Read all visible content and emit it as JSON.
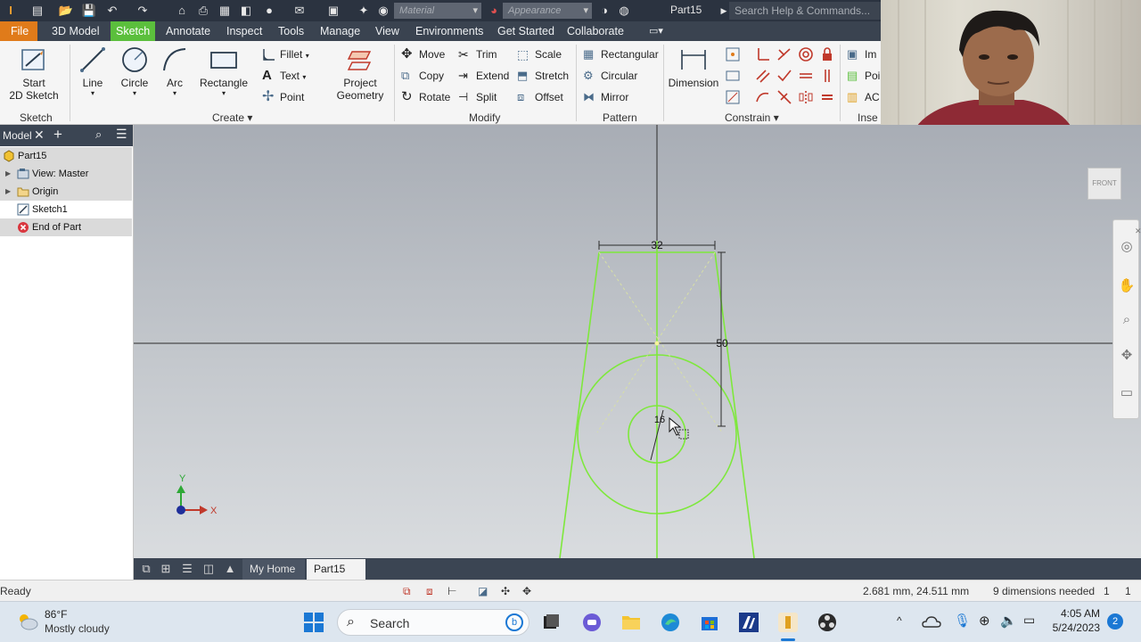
{
  "titlebar": {
    "doc_title": "Part15",
    "material_placeholder": "Material",
    "appearance_placeholder": "Appearance",
    "help_search_placeholder": "Search Help & Commands..."
  },
  "menu_tabs": [
    "File",
    "3D Model",
    "Sketch",
    "Annotate",
    "Inspect",
    "Tools",
    "Manage",
    "View",
    "Environments",
    "Get Started",
    "Collaborate"
  ],
  "active_tab": "Sketch",
  "ribbon": {
    "sketch_group": {
      "start_line1": "Start",
      "start_line2": "2D Sketch",
      "label": "Sketch"
    },
    "create_group": {
      "line": "Line",
      "circle": "Circle",
      "arc": "Arc",
      "rectangle": "Rectangle",
      "fillet": "Fillet",
      "text": "Text",
      "point": "Point",
      "label": "Create"
    },
    "project": {
      "line1": "Project",
      "line2": "Geometry"
    },
    "modify_group": {
      "move": "Move",
      "trim": "Trim",
      "scale": "Scale",
      "copy": "Copy",
      "extend": "Extend",
      "stretch": "Stretch",
      "rotate": "Rotate",
      "split": "Split",
      "offset": "Offset",
      "label": "Modify"
    },
    "pattern_group": {
      "rectangular": "Rectangular",
      "circular": "Circular",
      "mirror": "Mirror",
      "label": "Pattern"
    },
    "constrain_group": {
      "dimension": "Dimension",
      "label": "Constrain"
    },
    "insert_group": {
      "image": "Im",
      "points": "Poi",
      "acad": "AC",
      "label": "Inse"
    }
  },
  "browser": {
    "tab_label": "Model",
    "items": [
      {
        "label": "Part15",
        "icon": "part-icon"
      },
      {
        "label": "View: Master",
        "icon": "view-icon"
      },
      {
        "label": "Origin",
        "icon": "folder-icon"
      },
      {
        "label": "Sketch1",
        "icon": "sketch-icon"
      },
      {
        "label": "End of Part",
        "icon": "end-of-part-icon"
      }
    ]
  },
  "viewport": {
    "viewcube_label": "FRONT",
    "dimensions": {
      "top_width": "32",
      "height": "50",
      "circle_diameter": "16"
    },
    "axis_labels": {
      "y": "Y",
      "x": "X"
    }
  },
  "doc_tabs": {
    "home": "My Home",
    "part": "Part15"
  },
  "status": {
    "left": "Ready",
    "coords": "2.681 mm, 24.511 mm",
    "dims_needed": "9 dimensions needed",
    "count1": "1",
    "count2": "1"
  },
  "taskbar": {
    "weather_temp": "86°F",
    "weather_desc": "Mostly cloudy",
    "search_label": "Search",
    "time": "4:05 AM",
    "date": "5/24/2023",
    "notifications": "2"
  },
  "colors": {
    "sketch_green": "#7ee83c",
    "file_tab": "#e07b1a",
    "active_tab": "#5bbf3c",
    "title_bar": "#2b3340"
  }
}
